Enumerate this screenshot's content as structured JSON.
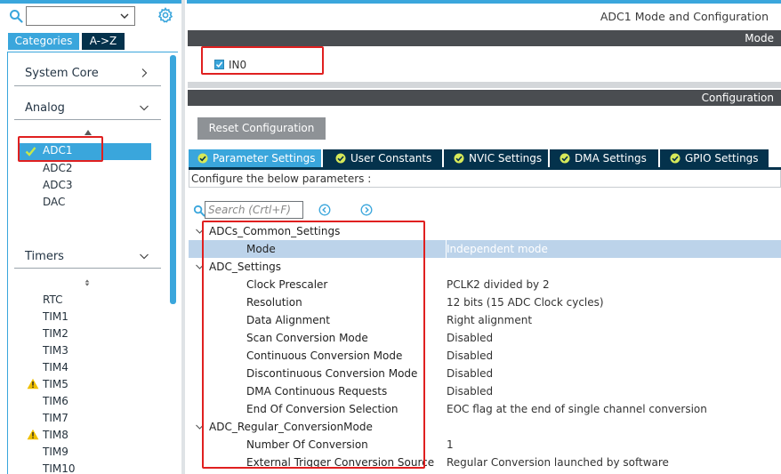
{
  "colors": {
    "accent": "#3aa6dc",
    "dark_navy": "#04324c",
    "section_bar": "#4a4d51",
    "highlight_red": "#e02020",
    "selected_row": "#bcd3ea",
    "warning": "#f0c000"
  },
  "left": {
    "combo_value": "",
    "tabs": {
      "categories": "Categories",
      "az": "A->Z"
    },
    "categories": [
      {
        "label": "System Core",
        "chevron": "chevron-right-icon"
      },
      {
        "label": "Analog",
        "chevron": "chevron-down-icon"
      },
      {
        "label": "Timers",
        "chevron": "chevron-down-icon"
      }
    ],
    "analog_items": [
      {
        "label": "ADC1",
        "selected": true,
        "status": "check-icon"
      },
      {
        "label": "ADC2"
      },
      {
        "label": "ADC3"
      },
      {
        "label": "DAC"
      }
    ],
    "timer_items": [
      {
        "label": "RTC"
      },
      {
        "label": "TIM1"
      },
      {
        "label": "TIM2"
      },
      {
        "label": "TIM3"
      },
      {
        "label": "TIM4"
      },
      {
        "label": "TIM5",
        "status": "warning-icon"
      },
      {
        "label": "TIM6"
      },
      {
        "label": "TIM7"
      },
      {
        "label": "TIM8",
        "status": "warning-icon"
      },
      {
        "label": "TIM9"
      },
      {
        "label": "TIM10"
      }
    ]
  },
  "right": {
    "title": "ADC1 Mode and Configuration",
    "mode_bar": "Mode",
    "mode_channel": {
      "label": "IN0",
      "checked": true
    },
    "config_bar": "Configuration",
    "reset_button": "Reset Configuration",
    "tabs": [
      {
        "label": "Parameter Settings",
        "active": true
      },
      {
        "label": "User Constants"
      },
      {
        "label": "NVIC Settings"
      },
      {
        "label": "DMA Settings"
      },
      {
        "label": "GPIO Settings"
      }
    ],
    "description": "Configure the below parameters :",
    "search_placeholder": "Search (Crtl+F)",
    "groups": [
      {
        "name": "ADCs_Common_Settings",
        "params": [
          {
            "name": "Mode",
            "value": "Independent mode",
            "selected": true
          }
        ]
      },
      {
        "name": "ADC_Settings",
        "params": [
          {
            "name": "Clock Prescaler",
            "value": "PCLK2 divided by 2"
          },
          {
            "name": "Resolution",
            "value": "12 bits (15 ADC Clock cycles)"
          },
          {
            "name": "Data Alignment",
            "value": "Right alignment"
          },
          {
            "name": "Scan Conversion Mode",
            "value": "Disabled"
          },
          {
            "name": "Continuous Conversion Mode",
            "value": "Disabled"
          },
          {
            "name": "Discontinuous Conversion Mode",
            "value": "Disabled"
          },
          {
            "name": "DMA Continuous Requests",
            "value": "Disabled"
          },
          {
            "name": "End Of Conversion Selection",
            "value": "EOC flag at the end of single channel conversion"
          }
        ]
      },
      {
        "name": "ADC_Regular_ConversionMode",
        "params": [
          {
            "name": "Number Of Conversion",
            "value": "1"
          },
          {
            "name": "External Trigger Conversion Source",
            "value": "Regular Conversion launched by software"
          }
        ]
      }
    ]
  }
}
